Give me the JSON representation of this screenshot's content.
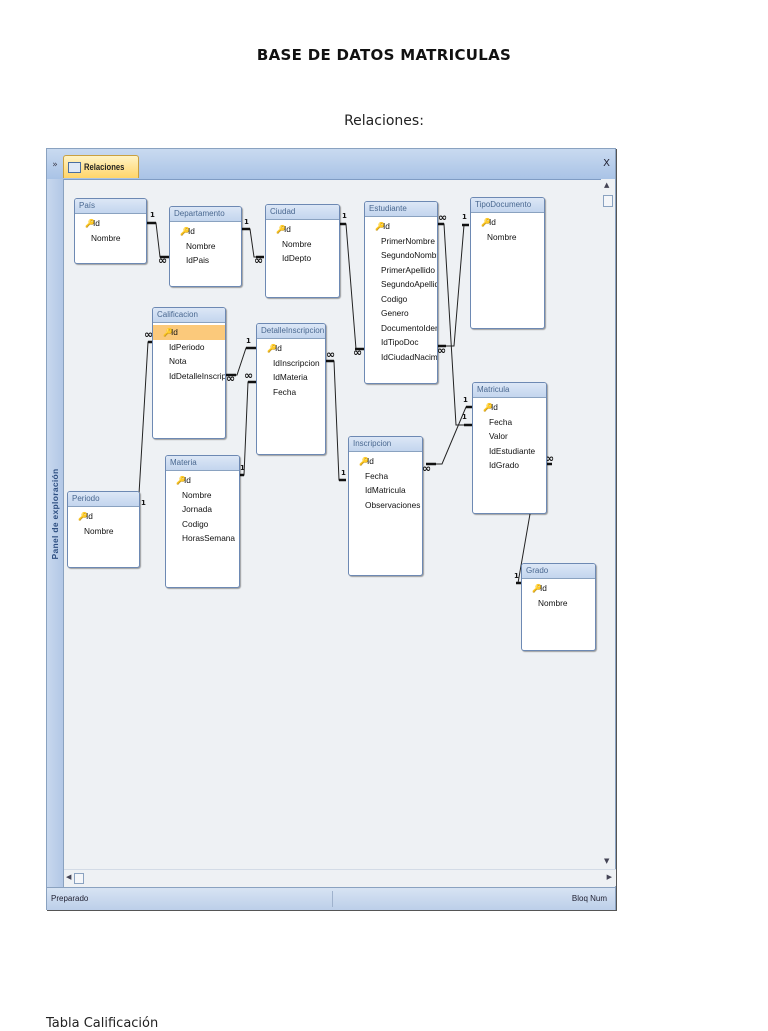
{
  "document": {
    "title": "BASE DE DATOS MATRICULAS",
    "subtitle": "Relaciones:",
    "bottom_text": "Tabla Calificación"
  },
  "window": {
    "tab_label": "Relaciones",
    "close": "X",
    "collapse": "»",
    "nav_pane_label": "Panel de exploración",
    "status_left": "Preparado",
    "status_right": "Bloq Num"
  },
  "tables": {
    "pais": {
      "title": "País",
      "fields": [
        "Id",
        "Nombre"
      ]
    },
    "departamento": {
      "title": "Departamento",
      "fields": [
        "Id",
        "Nombre",
        "IdPais"
      ]
    },
    "ciudad": {
      "title": "Ciudad",
      "fields": [
        "Id",
        "Nombre",
        "IdDepto"
      ]
    },
    "estudiante": {
      "title": "Estudiante",
      "fields": [
        "Id",
        "PrimerNombre",
        "SegundoNombre",
        "PrimerApellido",
        "SegundoApellido",
        "Codigo",
        "Genero",
        "DocumentoIdentida",
        "IdTipoDoc",
        "IdCiudadNacimiento"
      ]
    },
    "tipodocumento": {
      "title": "TipoDocumento",
      "fields": [
        "Id",
        "Nombre"
      ]
    },
    "calificacion": {
      "title": "Calificacion",
      "fields": [
        "Id",
        "IdPeriodo",
        "Nota",
        "IdDetalleInscripcion"
      ]
    },
    "detalleinscripcion": {
      "title": "DetalleInscripcion",
      "fields": [
        "Id",
        "IdInscripcion",
        "IdMateria",
        "Fecha"
      ]
    },
    "matricula": {
      "title": "Matricula",
      "fields": [
        "Id",
        "Fecha",
        "Valor",
        "IdEstudiante",
        "IdGrado"
      ]
    },
    "periodo": {
      "title": "Periodo",
      "fields": [
        "Id",
        "Nombre"
      ]
    },
    "materia": {
      "title": "Materia",
      "fields": [
        "Id",
        "Nombre",
        "Jornada",
        "Codigo",
        "HorasSemana"
      ]
    },
    "inscripcion": {
      "title": "Inscripcion",
      "fields": [
        "Id",
        "Fecha",
        "IdMatricula",
        "Observaciones"
      ]
    },
    "grado": {
      "title": "Grado",
      "fields": [
        "Id",
        "Nombre"
      ]
    }
  },
  "relationship_labels": {
    "one": "1",
    "many": "∞"
  }
}
